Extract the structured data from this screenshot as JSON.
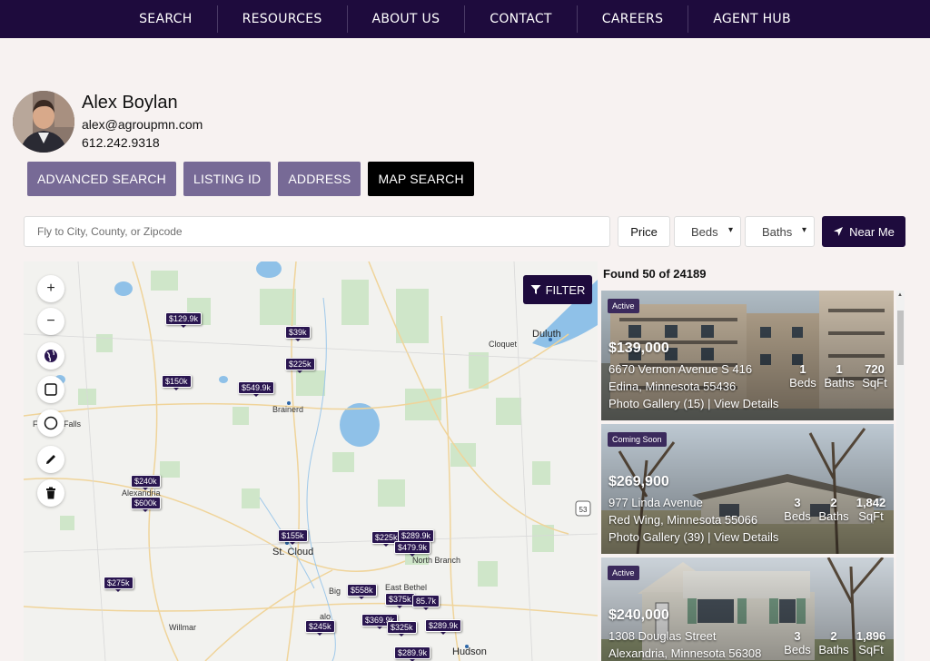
{
  "nav": [
    "SEARCH",
    "RESOURCES",
    "ABOUT US",
    "CONTACT",
    "CAREERS",
    "AGENT HUB"
  ],
  "agent": {
    "name": "Alex Boylan",
    "email": "alex@agroupmn.com",
    "phone": "612.242.9318"
  },
  "tabs": [
    "ADVANCED SEARCH",
    "LISTING ID",
    "ADDRESS",
    "MAP SEARCH"
  ],
  "active_tab": "MAP SEARCH",
  "search": {
    "placeholder": "Fly to City, County, or Zipcode",
    "value": ""
  },
  "filters": {
    "price": "Price",
    "beds": "Beds",
    "baths": "Baths",
    "near_me": "Near Me"
  },
  "map": {
    "filter_label": "FILTER",
    "controls": [
      "zoom-in",
      "zoom-out",
      "globe",
      "draw-rectangle",
      "draw-circle",
      "edit",
      "delete"
    ],
    "pins": [
      "$129.9k",
      "$39k",
      "$225k",
      "$150k",
      "$549.9k",
      "$240k",
      "$600k",
      "$155k",
      "$225k",
      "$289.9k",
      "$479.9k",
      "$275k",
      "$558k",
      "$375k",
      "85.7k",
      "$369.9k",
      "$325k",
      "$289.9k",
      "$245k",
      "$289.9k"
    ],
    "cities": [
      "Duluth",
      "Cloquet",
      "Brainerd",
      "Alexandria",
      "St. Cloud",
      "North Branch",
      "East Bethel",
      "Willmar",
      "Hudson"
    ],
    "partial_labels": [
      "F",
      "Falls",
      "Big",
      "alo"
    ]
  },
  "results": {
    "found_text": "Found 50 of 24189",
    "listings": [
      {
        "badge": "Active",
        "price": "$139,000",
        "street": "6670 Vernon Avenue S 416",
        "city": "Edina, Minnesota 55436",
        "beds": "1",
        "baths": "1",
        "sqft": "720",
        "gallery": "Photo Gallery (15) | View Details"
      },
      {
        "badge": "Coming Soon",
        "price": "$269,900",
        "street": "977 Linda Avenue",
        "city": "Red Wing, Minnesota 55066",
        "beds": "3",
        "baths": "2",
        "sqft": "1,842",
        "gallery": "Photo Gallery (39) | View Details"
      },
      {
        "badge": "Active",
        "price": "$240,000",
        "street": "1308 Douglas Street",
        "city": "Alexandria, Minnesota 56308",
        "beds": "3",
        "baths": "2",
        "sqft": "1,896",
        "gallery": ""
      }
    ],
    "labels": {
      "beds": "Beds",
      "baths": "Baths",
      "sqft": "SqFt"
    }
  }
}
